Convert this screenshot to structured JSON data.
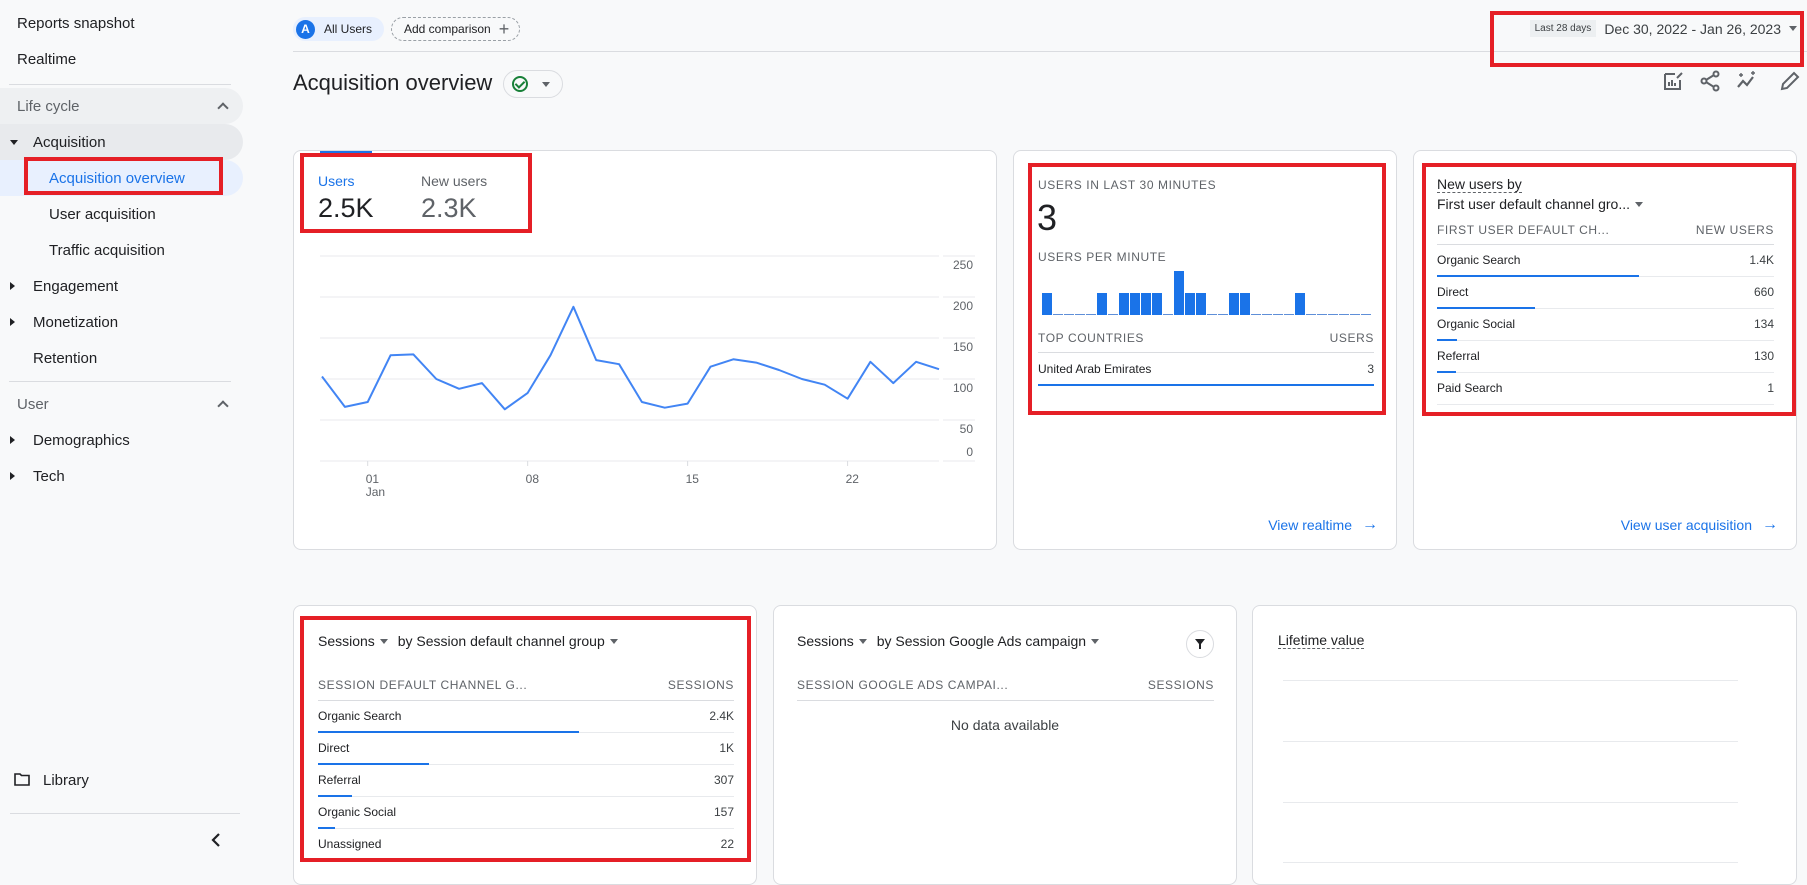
{
  "sidebar": {
    "top_items": [
      {
        "label": "Reports snapshot"
      },
      {
        "label": "Realtime"
      }
    ],
    "lifecycle": {
      "header": "Life cycle",
      "acquisition": {
        "label": "Acquisition",
        "children": [
          {
            "label": "Acquisition overview",
            "active": true
          },
          {
            "label": "User acquisition"
          },
          {
            "label": "Traffic acquisition"
          }
        ]
      },
      "engagement": "Engagement",
      "monetization": "Monetization",
      "retention": "Retention"
    },
    "user": {
      "header": "User",
      "demographics": "Demographics",
      "tech": "Tech"
    },
    "library": "Library"
  },
  "header": {
    "segment_avatar": "A",
    "segment_label": "All Users",
    "add_comparison": "Add comparison",
    "date_chip": "Last 28 days",
    "date_range": "Dec 30, 2022 - Jan 26, 2023",
    "title": "Acquisition overview"
  },
  "users_card": {
    "tabs": [
      {
        "label": "Users",
        "value": "2.5K",
        "active": true
      },
      {
        "label": "New users",
        "value": "2.3K"
      }
    ]
  },
  "realtime_card": {
    "title": "Users in last 30 minutes",
    "value": "3",
    "per_minute_label": "Users per minute",
    "countries_header": "Top countries",
    "users_header": "Users",
    "countries": [
      {
        "name": "United Arab Emirates",
        "value": "3",
        "share": 1.0
      }
    ],
    "link": "View realtime"
  },
  "new_users_card": {
    "title_line1": "New users by",
    "title_line2": "First user default channel gro...",
    "col1": "First user default ch...",
    "col2": "New users",
    "rows": [
      {
        "name": "Organic Search",
        "value": "1.4K",
        "share": 0.6
      },
      {
        "name": "Direct",
        "value": "660",
        "share": 0.29
      },
      {
        "name": "Organic Social",
        "value": "134",
        "share": 0.06
      },
      {
        "name": "Referral",
        "value": "130",
        "share": 0.055
      },
      {
        "name": "Paid Search",
        "value": "1",
        "share": 0.0
      }
    ],
    "link": "View user acquisition"
  },
  "sessions_card": {
    "metric": "Sessions",
    "dimension": "by Session default channel group",
    "col1": "Session default channel g...",
    "col2": "Sessions",
    "rows": [
      {
        "name": "Organic Search",
        "value": "2.4K",
        "share": 0.627
      },
      {
        "name": "Direct",
        "value": "1K",
        "share": 0.266
      },
      {
        "name": "Referral",
        "value": "307",
        "share": 0.081
      },
      {
        "name": "Organic Social",
        "value": "157",
        "share": 0.041
      },
      {
        "name": "Unassigned",
        "value": "22",
        "share": 0.006
      }
    ]
  },
  "ads_card": {
    "metric": "Sessions",
    "dimension": "by Session Google Ads campaign",
    "col1": "Session Google Ads campai...",
    "col2": "Sessions",
    "empty": "No data available"
  },
  "ltv_card": {
    "title": "Lifetime value"
  },
  "chart_data": [
    {
      "type": "line",
      "title": "Users",
      "xlabel": "",
      "ylabel": "",
      "x": [
        "Dec 30",
        "Dec 31",
        "Jan 01",
        "Jan 02",
        "Jan 03",
        "Jan 04",
        "Jan 05",
        "Jan 06",
        "Jan 07",
        "Jan 08",
        "Jan 09",
        "Jan 10",
        "Jan 11",
        "Jan 12",
        "Jan 13",
        "Jan 14",
        "Jan 15",
        "Jan 16",
        "Jan 17",
        "Jan 18",
        "Jan 19",
        "Jan 20",
        "Jan 21",
        "Jan 22",
        "Jan 23",
        "Jan 24",
        "Jan 25",
        "Jan 26"
      ],
      "series": [
        {
          "name": "Users",
          "color": "#4285f4",
          "values": [
            103,
            66,
            72,
            129,
            130,
            100,
            88,
            95,
            63,
            83,
            129,
            188,
            123,
            118,
            72,
            65,
            70,
            115,
            124,
            120,
            111,
            100,
            93,
            76,
            121,
            95,
            121,
            112
          ]
        }
      ],
      "x_ticks": [
        {
          "index": 2,
          "label": "01",
          "sub": "Jan"
        },
        {
          "index": 9,
          "label": "08"
        },
        {
          "index": 16,
          "label": "15"
        },
        {
          "index": 23,
          "label": "22"
        }
      ],
      "y_ticks": [
        0,
        50,
        100,
        150,
        200,
        250
      ],
      "ylim": [
        0,
        250
      ],
      "grid": true
    },
    {
      "type": "bar",
      "title": "Users per minute",
      "values": [
        1,
        0,
        0,
        0,
        0,
        1,
        0,
        1,
        1,
        1,
        1,
        0,
        2,
        1,
        1,
        0,
        0,
        1,
        1,
        0,
        0,
        0,
        0,
        1,
        0,
        0,
        0,
        0,
        0,
        0
      ],
      "color": "#1a73e8"
    }
  ]
}
